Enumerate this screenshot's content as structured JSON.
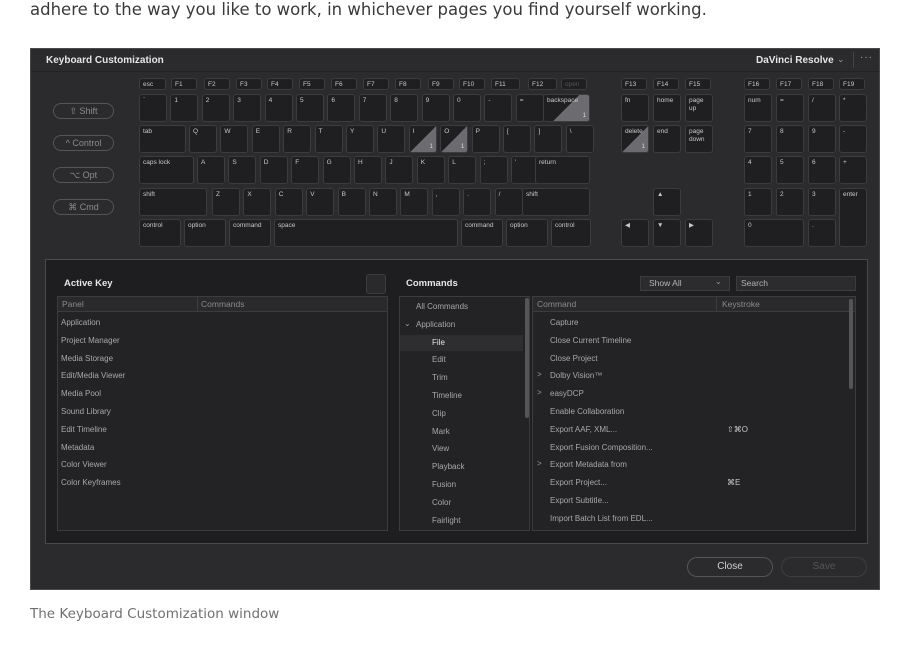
{
  "intro_text": "adhere to the way you like to work, in whichever pages you find yourself working.",
  "caption": "The Keyboard Customization window",
  "window": {
    "title": "Keyboard Customization",
    "preset": "DaVinci Resolve",
    "chevron_icon": "chevron-down-icon",
    "more_label": "···"
  },
  "modifiers": [
    "⇧ Shift",
    "^ Control",
    "⌥ Opt",
    "⌘ Cmd"
  ],
  "keyboard": {
    "fn_row": [
      "esc",
      "F1",
      "F2",
      "F3",
      "F4",
      "F5",
      "F6",
      "F7",
      "F8",
      "F9",
      "F10",
      "F11",
      "F12",
      "open"
    ],
    "nav_fn": [
      "F13",
      "F14",
      "F15"
    ],
    "pad_fn": [
      "F16",
      "F17",
      "F18",
      "F19"
    ],
    "num_row": [
      "`",
      "1",
      "2",
      "3",
      "4",
      "5",
      "6",
      "7",
      "8",
      "9",
      "0",
      "-",
      "=",
      "backspace"
    ],
    "tab_row": [
      "tab",
      "Q",
      "W",
      "E",
      "R",
      "T",
      "Y",
      "U",
      "I",
      "O",
      "P",
      "[",
      "]",
      "\\"
    ],
    "caps_row": [
      "caps lock",
      "A",
      "S",
      "D",
      "F",
      "G",
      "H",
      "J",
      "K",
      "L",
      ";",
      "'",
      "return"
    ],
    "shift_row": [
      "shift",
      "Z",
      "X",
      "C",
      "V",
      "B",
      "N",
      "M",
      ",",
      ".",
      "/",
      "shift"
    ],
    "bottom_row": [
      "control",
      "option",
      "command",
      "space",
      "command",
      "option",
      "control"
    ],
    "nav_top": [
      "fn",
      "home",
      "page up"
    ],
    "nav_bottom": [
      "delete",
      "end",
      "page down"
    ],
    "arrows": [
      "▲",
      "◀",
      "▼",
      "▶"
    ],
    "numpad_rows": [
      [
        "num",
        "=",
        "/",
        "*"
      ],
      [
        "7",
        "8",
        "9",
        "-"
      ],
      [
        "4",
        "5",
        "6",
        "+"
      ],
      [
        "1",
        "2",
        "3",
        "enter"
      ],
      [
        "0",
        ".",
        ""
      ]
    ],
    "assigned_count": "1"
  },
  "active_key": {
    "title": "Active Key",
    "col_panel": "Panel",
    "col_commands": "Commands",
    "panels": [
      "Application",
      "Project Manager",
      "Media Storage",
      "Edit/Media Viewer",
      "Media Pool",
      "Sound Library",
      "Edit Timeline",
      "Metadata",
      "Color Viewer",
      "Color Keyframes"
    ]
  },
  "commands": {
    "title": "Commands",
    "filter": "Show All",
    "search_placeholder": "Search",
    "tree": [
      "All Commands",
      "Application",
      "File",
      "Edit",
      "Trim",
      "Timeline",
      "Clip",
      "Mark",
      "View",
      "Playback",
      "Fusion",
      "Color",
      "Fairlight"
    ],
    "col_command": "Command",
    "col_keystroke": "Keystroke",
    "list": [
      {
        "command": "Capture",
        "keystroke": ""
      },
      {
        "command": "Close Current Timeline",
        "keystroke": ""
      },
      {
        "command": "Close Project",
        "keystroke": ""
      },
      {
        "command": "Dolby Vision™",
        "keystroke": "",
        "expandable": true
      },
      {
        "command": "easyDCP",
        "keystroke": "",
        "expandable": true
      },
      {
        "command": "Enable Collaboration",
        "keystroke": ""
      },
      {
        "command": "Export AAF, XML...",
        "keystroke": "⇧⌘O"
      },
      {
        "command": "Export Fusion Composition...",
        "keystroke": ""
      },
      {
        "command": "Export Metadata from",
        "keystroke": "",
        "expandable": true
      },
      {
        "command": "Export Project...",
        "keystroke": "⌘E"
      },
      {
        "command": "Export Subtitle...",
        "keystroke": ""
      },
      {
        "command": "Import Batch List from EDL...",
        "keystroke": ""
      }
    ]
  },
  "buttons": {
    "close": "Close",
    "save": "Save"
  }
}
